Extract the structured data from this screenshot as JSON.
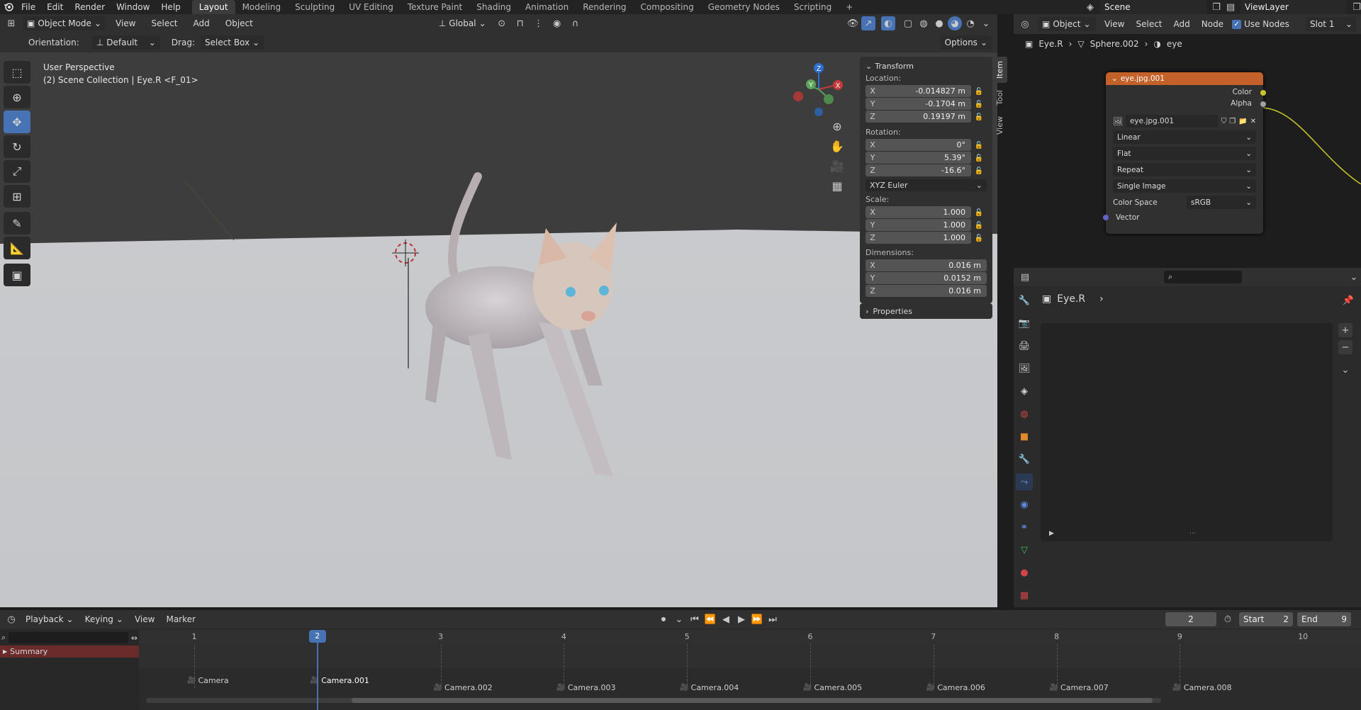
{
  "menu": {
    "items": [
      "File",
      "Edit",
      "Render",
      "Window",
      "Help"
    ],
    "tabs": [
      "Layout",
      "Modeling",
      "Sculpting",
      "UV Editing",
      "Texture Paint",
      "Shading",
      "Animation",
      "Rendering",
      "Compositing",
      "Geometry Nodes",
      "Scripting"
    ],
    "add_tab": "+",
    "scene": "Scene",
    "view_layer": "ViewLayer"
  },
  "viewport_header": {
    "mode": "Object Mode",
    "menus": [
      "View",
      "Select",
      "Add",
      "Object"
    ],
    "transform_orientation": "Global",
    "orientation_label": "Orientation:",
    "orientation_value": "Default",
    "drag_label": "Drag:",
    "drag_value": "Select Box",
    "options": "Options"
  },
  "viewport": {
    "perspective": "User Perspective",
    "collection": "(2) Scene Collection | Eye.R <F_01>",
    "gizmo_axes": [
      "X",
      "Y",
      "Z"
    ]
  },
  "npanel": {
    "tabs": [
      "Item",
      "Tool",
      "View"
    ],
    "transform_title": "Transform",
    "location_label": "Location:",
    "location": [
      {
        "axis": "X",
        "value": "-0.014827 m"
      },
      {
        "axis": "Y",
        "value": "-0.1704 m"
      },
      {
        "axis": "Z",
        "value": "0.19197 m"
      }
    ],
    "rotation_label": "Rotation:",
    "rotation": [
      {
        "axis": "X",
        "value": "0°"
      },
      {
        "axis": "Y",
        "value": "5.39°"
      },
      {
        "axis": "Z",
        "value": "-16.6°"
      }
    ],
    "rotation_mode": "XYZ Euler",
    "scale_label": "Scale:",
    "scale": [
      {
        "axis": "X",
        "value": "1.000"
      },
      {
        "axis": "Y",
        "value": "1.000"
      },
      {
        "axis": "Z",
        "value": "1.000"
      }
    ],
    "dimensions_label": "Dimensions:",
    "dimensions": [
      {
        "axis": "X",
        "value": "0.016 m"
      },
      {
        "axis": "Y",
        "value": "0.0152 m"
      },
      {
        "axis": "Z",
        "value": "0.016 m"
      }
    ],
    "properties_title": "Properties"
  },
  "node_editor": {
    "object_mode": "Object",
    "menus": [
      "View",
      "Select",
      "Add",
      "Node"
    ],
    "use_nodes": "Use Nodes",
    "slot": "Slot 1",
    "breadcrumb": [
      "Eye.R",
      "Sphere.002",
      "eye"
    ],
    "node": {
      "title": "eye.jpg.001",
      "outputs": [
        "Color",
        "Alpha"
      ],
      "image": "eye.jpg.001",
      "interpolation": "Linear",
      "projection": "Flat",
      "extension": "Repeat",
      "source": "Single Image",
      "color_space_label": "Color Space",
      "color_space": "sRGB",
      "input": "Vector"
    }
  },
  "properties_editor": {
    "object_name": "Eye.R",
    "search_placeholder": ""
  },
  "timeline": {
    "menus": [
      "Playback",
      "Keying",
      "View",
      "Marker"
    ],
    "current_frame": "2",
    "start_label": "Start",
    "start": "2",
    "end_label": "End",
    "end": "9",
    "frames": [
      "1",
      "2",
      "3",
      "4",
      "5",
      "6",
      "7",
      "8",
      "9",
      "10"
    ],
    "summary": "Summary",
    "markers": [
      "Camera",
      "Camera.001",
      "Camera.002",
      "Camera.003",
      "Camera.004",
      "Camera.005",
      "Camera.006",
      "Camera.007",
      "Camera.008"
    ]
  },
  "colors": {
    "accent": "#4772b3",
    "node_header": "#c4612a",
    "socket_color": "#c7c729",
    "socket_vector": "#6363c7"
  }
}
